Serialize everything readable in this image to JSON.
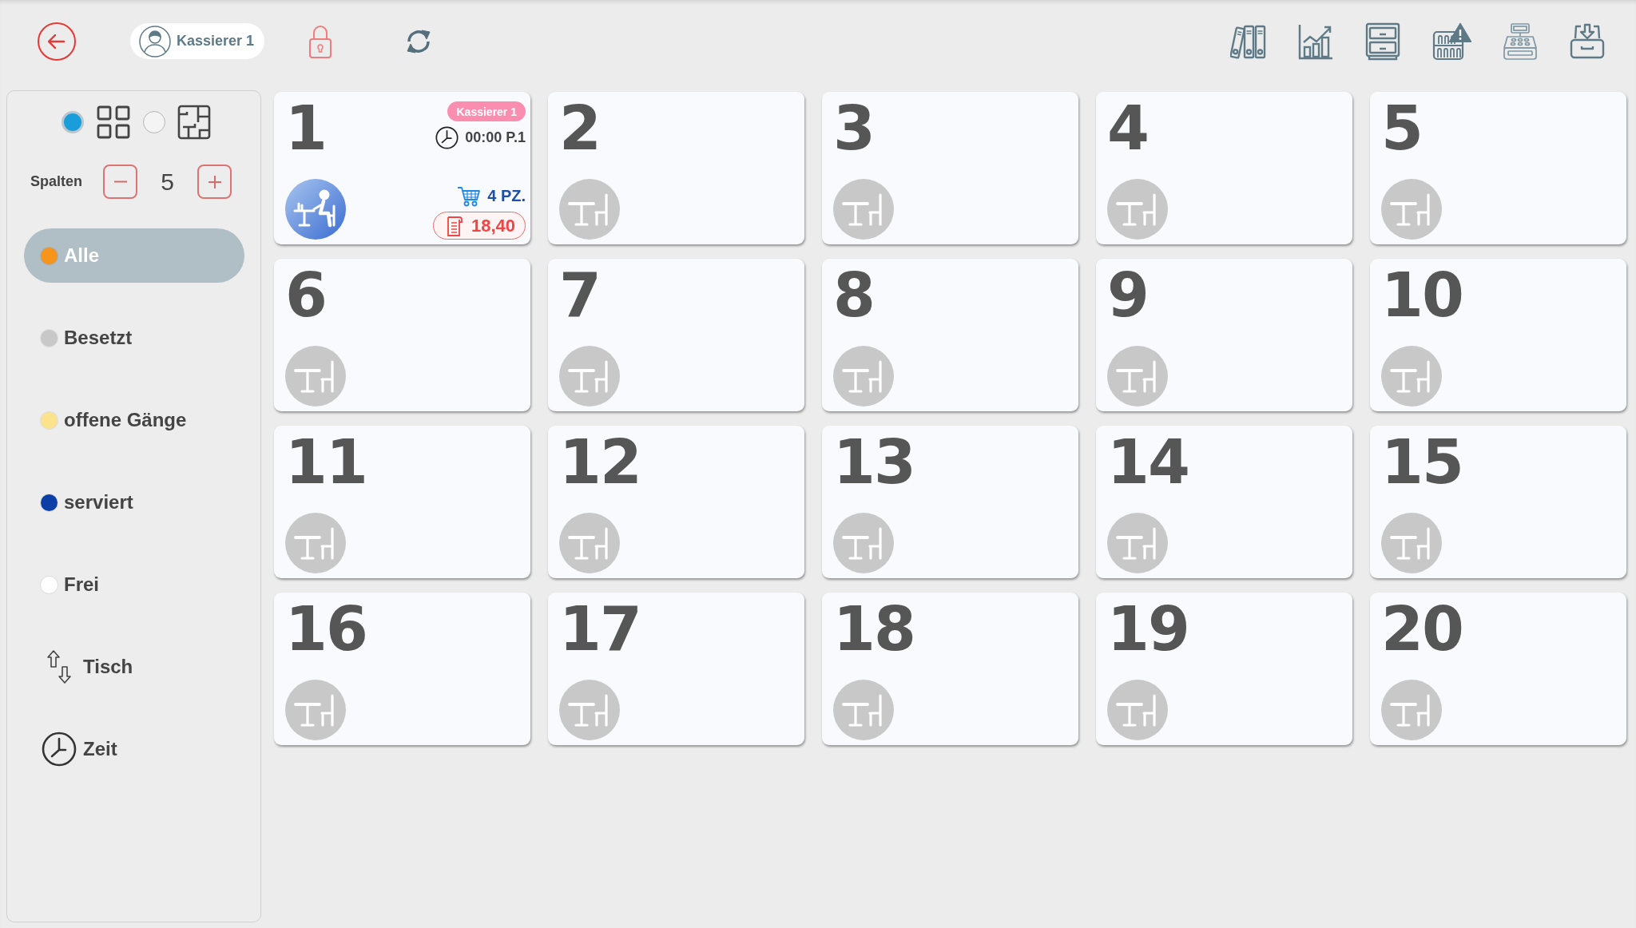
{
  "top_bar": {
    "user": "Kassierer 1"
  },
  "sidebar": {
    "view_modes": [
      {
        "kind": "grid",
        "selected": true
      },
      {
        "kind": "floorplan",
        "selected": false
      }
    ],
    "columns": {
      "label": "Spalten",
      "value": "5"
    },
    "filters": [
      {
        "label": "Alle",
        "color": "#f7941d",
        "selected": true
      },
      {
        "label": "Besetzt",
        "color": "#c8c8c8",
        "selected": false
      },
      {
        "label": "offene Gänge",
        "color": "#fbe38e",
        "selected": false
      },
      {
        "label": "serviert",
        "color": "#0b3fa6",
        "selected": false
      },
      {
        "label": "Frei",
        "color": "#ffffff",
        "selected": false
      }
    ],
    "sort_options": [
      {
        "kind": "table",
        "label": "Tisch"
      },
      {
        "kind": "time",
        "label": "Zeit"
      }
    ]
  },
  "tables": [
    {
      "number": "1",
      "occupied": true,
      "cashier": "Kassierer 1",
      "time": "00:00 P.1",
      "items": "4 PZ.",
      "total": "18,40"
    },
    {
      "number": "2",
      "occupied": false
    },
    {
      "number": "3",
      "occupied": false
    },
    {
      "number": "4",
      "occupied": false
    },
    {
      "number": "5",
      "occupied": false
    },
    {
      "number": "6",
      "occupied": false
    },
    {
      "number": "7",
      "occupied": false
    },
    {
      "number": "8",
      "occupied": false
    },
    {
      "number": "9",
      "occupied": false
    },
    {
      "number": "10",
      "occupied": false
    },
    {
      "number": "11",
      "occupied": false
    },
    {
      "number": "12",
      "occupied": false
    },
    {
      "number": "13",
      "occupied": false
    },
    {
      "number": "14",
      "occupied": false
    },
    {
      "number": "15",
      "occupied": false
    },
    {
      "number": "16",
      "occupied": false
    },
    {
      "number": "17",
      "occupied": false
    },
    {
      "number": "18",
      "occupied": false
    },
    {
      "number": "19",
      "occupied": false
    },
    {
      "number": "20",
      "occupied": false
    }
  ]
}
